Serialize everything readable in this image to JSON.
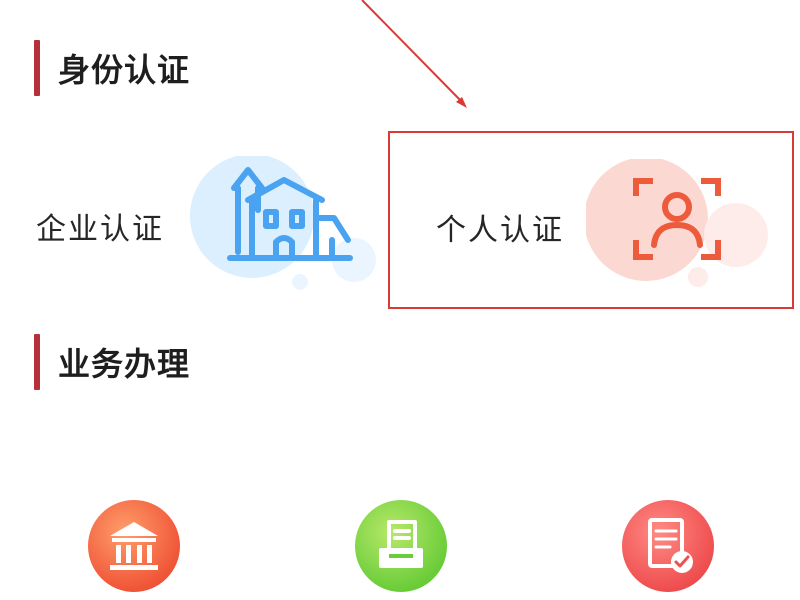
{
  "sections": {
    "identity": {
      "title": "身份认证"
    },
    "business": {
      "title": "业务办理"
    }
  },
  "cards": {
    "enterprise": {
      "label": "企业认证",
      "icon": "building-icon",
      "color": "#4aa3f0"
    },
    "personal": {
      "label": "个人认证",
      "icon": "face-scan-icon",
      "color": "#ee5a3c",
      "highlighted": true
    }
  },
  "business_items": [
    {
      "icon": "bank-icon",
      "color": "#f05638"
    },
    {
      "icon": "document-tray-icon",
      "color": "#6ccd3a"
    },
    {
      "icon": "checklist-icon",
      "color": "#ef4f50"
    }
  ],
  "colors": {
    "section_bar": "#b5313a",
    "highlight_border": "#d93a35"
  }
}
